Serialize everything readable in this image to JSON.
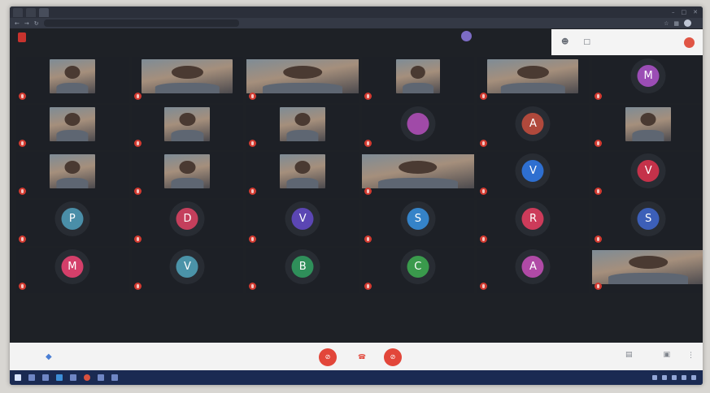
{
  "browser": {
    "tabs": [
      "",
      "",
      ""
    ],
    "url": "",
    "profile_label": ""
  },
  "meeting": {
    "record_badge": "",
    "presenter_name": "",
    "presenter_role": "",
    "participant_count": "",
    "meeting_code": ""
  },
  "participants": [
    {
      "type": "video",
      "name": "",
      "w": 56
    },
    {
      "type": "video",
      "name": "",
      "w": 112
    },
    {
      "type": "video",
      "name": "",
      "w": 140
    },
    {
      "type": "video",
      "name": "",
      "w": 54
    },
    {
      "type": "video",
      "name": "",
      "w": 112
    },
    {
      "type": "avatar",
      "letter": "M",
      "color": "#9b4db5",
      "name": ""
    },
    {
      "type": "video",
      "name": "",
      "w": 56
    },
    {
      "type": "video",
      "name": "",
      "w": 56
    },
    {
      "type": "video",
      "name": "",
      "w": 56
    },
    {
      "type": "avatar",
      "letter": "",
      "color": "#a04aa8",
      "name": ""
    },
    {
      "type": "avatar",
      "letter": "A",
      "color": "#b0493c",
      "name": ""
    },
    {
      "type": "video",
      "name": "",
      "w": 56
    },
    {
      "type": "video",
      "name": "",
      "w": 56
    },
    {
      "type": "video",
      "name": "",
      "w": 56
    },
    {
      "type": "video",
      "name": "",
      "w": 56
    },
    {
      "type": "video",
      "name": "",
      "w": 140
    },
    {
      "type": "avatar",
      "letter": "V",
      "color": "#2e6fd0",
      "name": ""
    },
    {
      "type": "avatar",
      "letter": "V",
      "color": "#c5324a",
      "name": ""
    },
    {
      "type": "avatar",
      "letter": "P",
      "color": "#4a8ea8",
      "name": ""
    },
    {
      "type": "avatar",
      "letter": "D",
      "color": "#c43f5c",
      "name": ""
    },
    {
      "type": "avatar",
      "letter": "V",
      "color": "#5b46b3",
      "name": ""
    },
    {
      "type": "avatar",
      "letter": "S",
      "color": "#3583c8",
      "name": ""
    },
    {
      "type": "avatar",
      "letter": "R",
      "color": "#cc3b5a",
      "name": ""
    },
    {
      "type": "avatar",
      "letter": "S",
      "color": "#3c5fb8",
      "name": ""
    },
    {
      "type": "avatar",
      "letter": "M",
      "color": "#d43f6a",
      "name": ""
    },
    {
      "type": "avatar",
      "letter": "V",
      "color": "#4b93a8",
      "name": ""
    },
    {
      "type": "avatar",
      "letter": "B",
      "color": "#2f8f5a",
      "name": ""
    },
    {
      "type": "avatar",
      "letter": "C",
      "color": "#3a9a4c",
      "name": ""
    },
    {
      "type": "avatar",
      "letter": "A",
      "color": "#b04aa6",
      "name": ""
    },
    {
      "type": "video",
      "name": "",
      "w": 140
    }
  ],
  "controls": {
    "mic_glyph": "⊘",
    "hangup_glyph": "☎",
    "cam_glyph": "⊘",
    "captions_label": "",
    "present_label": "",
    "more_glyph": "⋮"
  }
}
